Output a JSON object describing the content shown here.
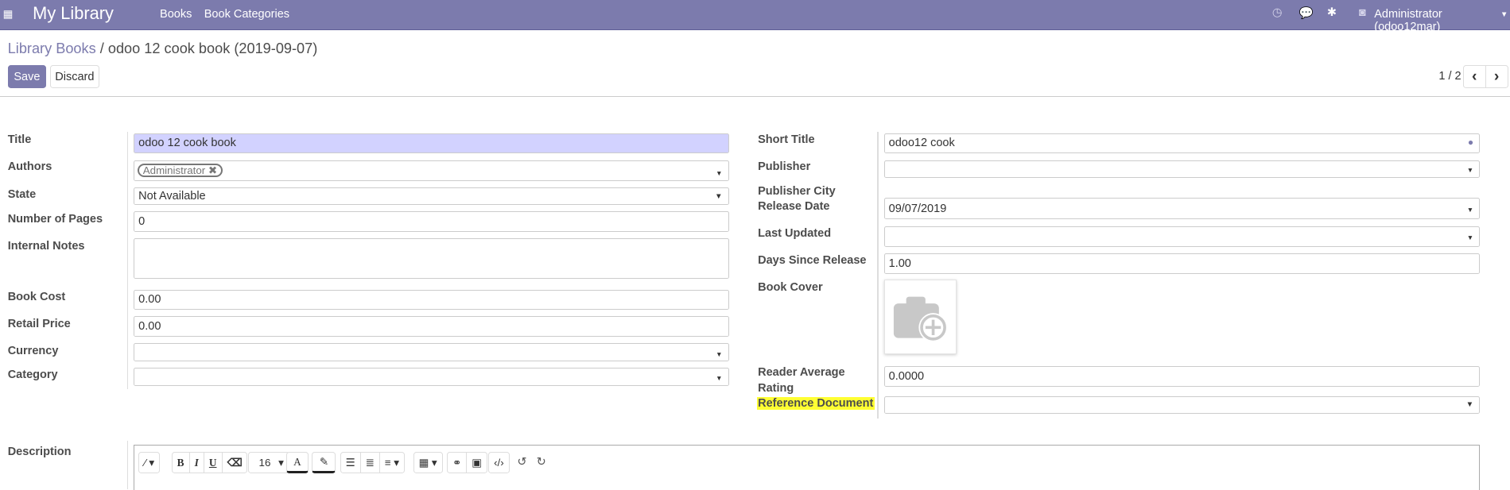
{
  "navbar": {
    "app_title": "My Library",
    "menu": [
      "Books",
      "Book Categories"
    ],
    "user": "Administrator (odoo12mar)",
    "color": "#7C7BAD"
  },
  "breadcrumb": {
    "parent": "Library Books",
    "separator": "/",
    "current": "odoo 12 cook book (2019-09-07)"
  },
  "toolbar": {
    "save": "Save",
    "discard": "Discard",
    "pager": "1 / 2",
    "prev": "‹",
    "next": "›"
  },
  "form": {
    "left": {
      "title": {
        "label": "Title",
        "value": "odoo 12 cook book"
      },
      "authors": {
        "label": "Authors",
        "tags": [
          "Administrator"
        ]
      },
      "state": {
        "label": "State",
        "value": "Not Available"
      },
      "pages": {
        "label": "Number of Pages",
        "value": "0"
      },
      "notes": {
        "label": "Internal Notes",
        "value": ""
      },
      "cost": {
        "label": "Book Cost",
        "value": "0.00"
      },
      "retail": {
        "label": "Retail Price",
        "value": "0.00"
      },
      "currency": {
        "label": "Currency",
        "value": ""
      },
      "category": {
        "label": "Category",
        "value": ""
      }
    },
    "right": {
      "short_title": {
        "label": "Short Title",
        "value": "odoo12 cook"
      },
      "publisher": {
        "label": "Publisher",
        "value": ""
      },
      "publisher_city": {
        "label": "Publisher City"
      },
      "release_date": {
        "label": "Release Date",
        "value": "09/07/2019"
      },
      "last_updated": {
        "label": "Last Updated",
        "value": ""
      },
      "days_since": {
        "label": "Days Since Release",
        "value": "1.00"
      },
      "cover": {
        "label": "Book Cover"
      },
      "rating": {
        "label_1": "Reader Average",
        "label_2": "Rating",
        "value": "0.0000"
      },
      "reference": {
        "label": "Reference Document",
        "value": "",
        "highlight": "#ffff33"
      }
    },
    "description": {
      "label": "Description",
      "font_size": "16"
    }
  }
}
